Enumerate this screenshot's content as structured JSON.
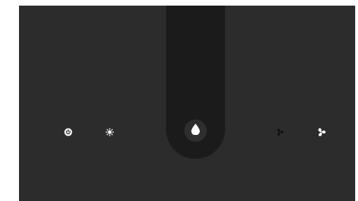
{
  "controls": {
    "power": {
      "icon": "power-icon",
      "color": "#ffffff"
    },
    "brightness": {
      "icon": "brightness-icon",
      "color": "#ffffff"
    },
    "humidity": {
      "icon": "water-drop-icon",
      "color": "#ffffff"
    },
    "fan_low": {
      "icon": "fan-icon",
      "color": "#111111"
    },
    "fan_high": {
      "icon": "fan-icon",
      "color": "#ffffff"
    }
  },
  "colors": {
    "panel": "#2c2c2c",
    "slot": "#1b1b1b",
    "page": "#ffffff"
  }
}
